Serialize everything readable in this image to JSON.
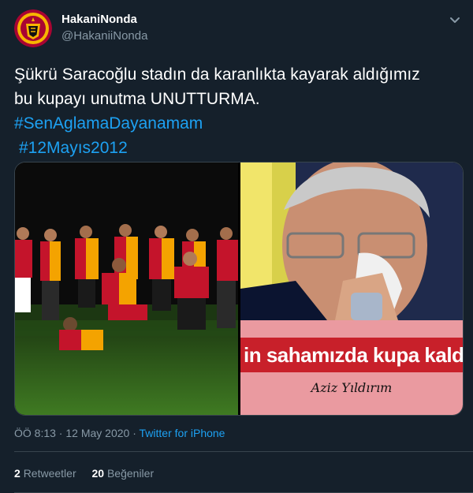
{
  "author": {
    "display_name": "HakaniNonda",
    "handle": "@HakaniiNonda",
    "avatar_icon": "galatasaray-crest-icon"
  },
  "tweet": {
    "text_line_1": "Şükrü Saracoğlu stadın da karanlıkta kayarak aldığımız",
    "text_line_2": "bu kupayı unutma UNUTTURMA.",
    "hashtag_1": "#SenAglamaDayanamam",
    "hashtag_2": "#12Mayıs2012"
  },
  "media": {
    "right_banner_text": "in sahamızda kupa kaldı",
    "right_banner_signature": "Aziz Yıldırım"
  },
  "meta": {
    "time": "ÖÖ 8:13",
    "separator_1": " · ",
    "date": "12 May 2020",
    "separator_2": " · ",
    "source": "Twitter for iPhone"
  },
  "stats": {
    "retweets_count": "2",
    "retweets_label": "Retweetler",
    "likes_count": "20",
    "likes_label": "Beğeniler"
  },
  "colors": {
    "background": "#15202b",
    "accent": "#1da1f2",
    "muted": "#8899a6",
    "border": "#38444d"
  }
}
